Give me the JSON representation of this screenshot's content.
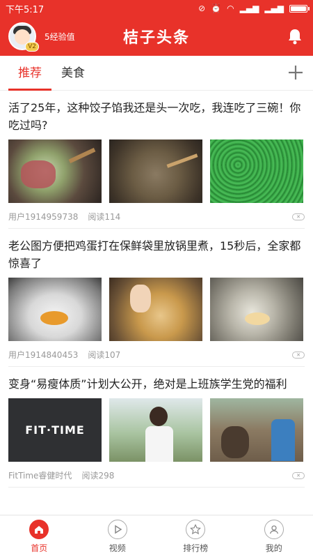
{
  "status": {
    "time": "下午5:17"
  },
  "header": {
    "exp_label": "5经验值",
    "level": "V2",
    "logo": "桔子头条"
  },
  "tabs": [
    {
      "label": "推荐",
      "active": true
    },
    {
      "label": "美食",
      "active": false
    }
  ],
  "articles": [
    {
      "title": "活了25年，这种饺子馅我还是头一次吃，我连吃了三碗！你吃过吗?",
      "source": "用户1914959738",
      "reads": "阅读114",
      "dismiss": "✕"
    },
    {
      "title": "老公图方便把鸡蛋打在保鲜袋里放锅里煮，15秒后，全家都惊喜了",
      "source": "用户1914840453",
      "reads": "阅读107",
      "dismiss": "✕"
    },
    {
      "title": "变身“易瘦体质”计划大公开，绝对是上班族学生党的福利",
      "source": "FitTime睿健时代",
      "reads": "阅读298",
      "dismiss": "✕",
      "thumb_text": "FIT·TIME"
    }
  ],
  "nav": [
    {
      "label": "首页",
      "icon": "home-icon",
      "active": true
    },
    {
      "label": "视频",
      "icon": "play-icon",
      "active": false
    },
    {
      "label": "排行榜",
      "icon": "star-icon",
      "active": false
    },
    {
      "label": "我的",
      "icon": "user-icon",
      "active": false
    }
  ],
  "colors": {
    "accent": "#e8322a"
  }
}
